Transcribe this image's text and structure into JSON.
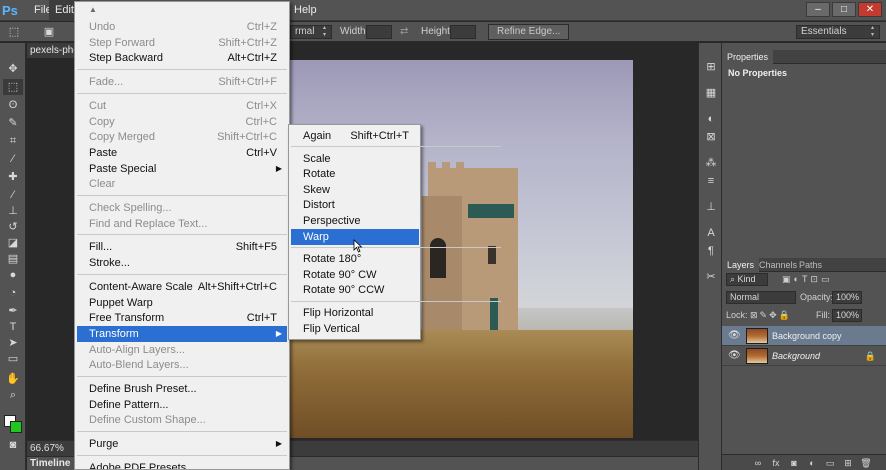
{
  "app": {
    "logo": "Ps"
  },
  "menubar": {
    "items": [
      "File",
      "Edit",
      "Help"
    ]
  },
  "window_controls": {
    "minimize": "–",
    "maximize": "□",
    "close": "✕"
  },
  "options_bar": {
    "style_value": "rmal",
    "width_label": "Width:",
    "height_label": "Height:",
    "refine_edge": "Refine Edge...",
    "workspace": "Essentials"
  },
  "document": {
    "tab_title": "pexels-pho",
    "zoom": "66.67%"
  },
  "timeline": {
    "label": "Timeline"
  },
  "properties_panel": {
    "tab": "Properties",
    "content": "No Properties"
  },
  "layers_panel": {
    "tabs": [
      "Layers",
      "Channels",
      "Paths"
    ],
    "filter_kind": "Kind",
    "blend_mode": "Normal",
    "opacity_label": "Opacity:",
    "opacity_value": "100%",
    "lock_label": "Lock:",
    "fill_label": "Fill:",
    "fill_value": "100%",
    "layers": [
      {
        "name": "Background copy",
        "selected": true,
        "italic": false,
        "locked": false
      },
      {
        "name": "Background",
        "selected": false,
        "italic": true,
        "locked": true
      }
    ]
  },
  "edit_menu": {
    "groups": [
      [
        {
          "label": "Undo",
          "shortcut": "Ctrl+Z",
          "disabled": true
        },
        {
          "label": "Step Forward",
          "shortcut": "Shift+Ctrl+Z",
          "disabled": true
        },
        {
          "label": "Step Backward",
          "shortcut": "Alt+Ctrl+Z",
          "disabled": false
        }
      ],
      [
        {
          "label": "Fade...",
          "shortcut": "Shift+Ctrl+F",
          "disabled": true
        }
      ],
      [
        {
          "label": "Cut",
          "shortcut": "Ctrl+X",
          "disabled": true
        },
        {
          "label": "Copy",
          "shortcut": "Ctrl+C",
          "disabled": true
        },
        {
          "label": "Copy Merged",
          "shortcut": "Shift+Ctrl+C",
          "disabled": true
        },
        {
          "label": "Paste",
          "shortcut": "Ctrl+V",
          "disabled": false
        },
        {
          "label": "Paste Special",
          "shortcut": "",
          "disabled": false,
          "submenu": true
        },
        {
          "label": "Clear",
          "shortcut": "",
          "disabled": true
        }
      ],
      [
        {
          "label": "Check Spelling...",
          "shortcut": "",
          "disabled": true
        },
        {
          "label": "Find and Replace Text...",
          "shortcut": "",
          "disabled": true
        }
      ],
      [
        {
          "label": "Fill...",
          "shortcut": "Shift+F5",
          "disabled": false
        },
        {
          "label": "Stroke...",
          "shortcut": "",
          "disabled": false
        }
      ],
      [
        {
          "label": "Content-Aware Scale",
          "shortcut": "Alt+Shift+Ctrl+C",
          "disabled": false
        },
        {
          "label": "Puppet Warp",
          "shortcut": "",
          "disabled": false
        },
        {
          "label": "Free Transform",
          "shortcut": "Ctrl+T",
          "disabled": false
        },
        {
          "label": "Transform",
          "shortcut": "",
          "disabled": false,
          "submenu": true,
          "highlighted": true
        },
        {
          "label": "Auto-Align Layers...",
          "shortcut": "",
          "disabled": true
        },
        {
          "label": "Auto-Blend Layers...",
          "shortcut": "",
          "disabled": true
        }
      ],
      [
        {
          "label": "Define Brush Preset...",
          "shortcut": "",
          "disabled": false
        },
        {
          "label": "Define Pattern...",
          "shortcut": "",
          "disabled": false
        },
        {
          "label": "Define Custom Shape...",
          "shortcut": "",
          "disabled": true
        }
      ],
      [
        {
          "label": "Purge",
          "shortcut": "",
          "disabled": false,
          "submenu": true
        }
      ],
      [
        {
          "label": "Adobe PDF Presets...",
          "shortcut": "",
          "disabled": false
        }
      ]
    ]
  },
  "transform_menu": {
    "groups": [
      [
        {
          "label": "Again",
          "shortcut": "Shift+Ctrl+T"
        }
      ],
      [
        {
          "label": "Scale",
          "shortcut": ""
        },
        {
          "label": "Rotate",
          "shortcut": ""
        },
        {
          "label": "Skew",
          "shortcut": ""
        },
        {
          "label": "Distort",
          "shortcut": ""
        },
        {
          "label": "Perspective",
          "shortcut": ""
        },
        {
          "label": "Warp",
          "shortcut": "",
          "highlighted": true
        }
      ],
      [
        {
          "label": "Rotate 180°",
          "shortcut": ""
        },
        {
          "label": "Rotate 90° CW",
          "shortcut": ""
        },
        {
          "label": "Rotate 90° CCW",
          "shortcut": ""
        }
      ],
      [
        {
          "label": "Flip Horizontal",
          "shortcut": ""
        },
        {
          "label": "Flip Vertical",
          "shortcut": ""
        }
      ]
    ]
  },
  "icons": {
    "tools": [
      "move-icon",
      "marquee-icon",
      "lasso-icon",
      "quick-select-icon",
      "crop-icon",
      "eyedropper-icon",
      "healing-icon",
      "brush-icon",
      "stamp-icon",
      "history-brush-icon",
      "eraser-icon",
      "gradient-icon",
      "blur-icon",
      "dodge-icon",
      "pen-icon",
      "type-icon",
      "path-select-icon",
      "shape-icon",
      "hand-icon",
      "zoom-icon"
    ],
    "accent_blue": "#2a6fd1"
  }
}
